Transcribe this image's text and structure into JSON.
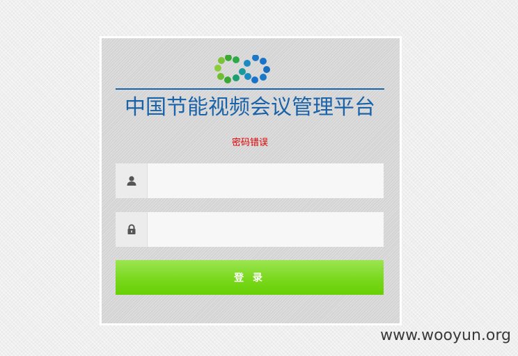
{
  "app": {
    "title": "中国节能视频会议管理平台",
    "error_message": "密码错误"
  },
  "form": {
    "username": {
      "value": "",
      "placeholder": "",
      "icon": "user-icon"
    },
    "password": {
      "value": "",
      "placeholder": "",
      "icon": "lock-icon"
    },
    "login_label": "登 录"
  },
  "watermark": "www.wooyun.org",
  "colors": {
    "brand_blue": "#1a63a8",
    "error_red": "#e00000",
    "button_green": "#79d81c",
    "logo_green": "#5cb82e",
    "logo_teal": "#1aa08a",
    "logo_blue": "#1a73c8"
  }
}
